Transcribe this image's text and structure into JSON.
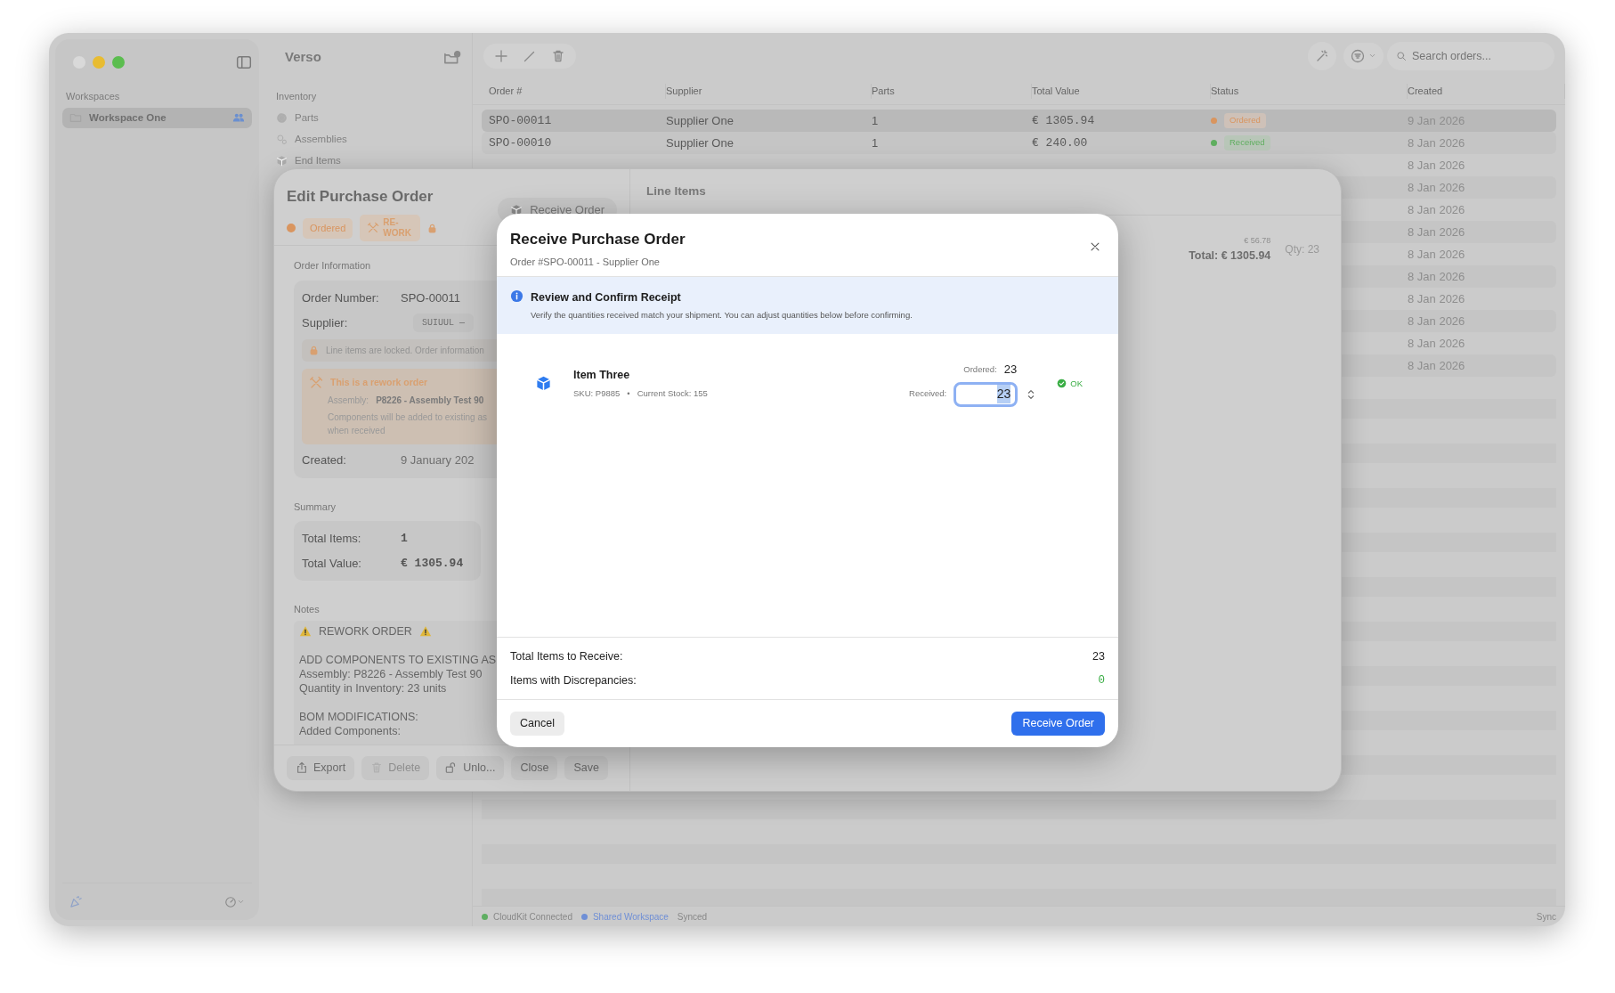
{
  "sidebar": {
    "section": "Workspaces",
    "items": [
      {
        "label": "Workspace One",
        "selected": true,
        "shared": true
      }
    ]
  },
  "middle": {
    "title": "Verso",
    "section": "Inventory",
    "items": [
      {
        "label": "Parts",
        "kind": "gear"
      },
      {
        "label": "Assemblies",
        "kind": "gears"
      },
      {
        "label": "End Items",
        "kind": "box"
      }
    ]
  },
  "toolbar": {
    "search": {
      "placeholder": "Search orders..."
    }
  },
  "table": {
    "columns": [
      "Order #",
      "Supplier",
      "Parts",
      "Total Value",
      "Status",
      "Created"
    ],
    "rows": [
      {
        "order": "SPO-00011",
        "supplier": "Supplier One",
        "parts": "1",
        "total": "€ 1305.94",
        "status": "Ordered",
        "color": "#d9955f",
        "created": "9 Jan 2026",
        "selected": true
      },
      {
        "order": "SPO-00010",
        "supplier": "Supplier One",
        "parts": "1",
        "total": "€ 240.00",
        "status": "Received",
        "color": "#5fae5f",
        "created": "8 Jan 2026",
        "selected": false
      },
      {
        "created": "8 Jan 2026",
        "selected": false
      },
      {
        "created": "8 Jan 2026",
        "selected": false
      },
      {
        "created": "8 Jan 2026",
        "selected": false
      },
      {
        "created": "8 Jan 2026",
        "selected": false
      },
      {
        "created": "8 Jan 2026",
        "selected": false
      },
      {
        "created": "8 Jan 2026",
        "selected": false
      },
      {
        "created": "8 Jan 2026",
        "selected": false
      },
      {
        "created": "8 Jan 2026",
        "selected": false
      },
      {
        "created": "8 Jan 2026",
        "selected": false
      },
      {
        "created": "8 Jan 2026",
        "selected": false
      }
    ]
  },
  "status_bar": {
    "items": [
      {
        "label": "CloudKit Connected",
        "color": "#5fae62",
        "kind": "plain"
      },
      {
        "label": "Shared Workspace",
        "color": "#6f8fd6",
        "kind": "link"
      }
    ],
    "state": "Synced",
    "right": "Sync"
  },
  "edit_sheet": {
    "title": "Edit Purchase Order",
    "status": {
      "label": "Ordered",
      "color": "#d9955f"
    },
    "rework_badge": "RE-WORK",
    "locked": true,
    "receive_button": "Receive Order",
    "order_info": {
      "heading": "Order Information",
      "order_number": {
        "label": "Order Number:",
        "value": "SPO-00011"
      },
      "supplier": {
        "label": "Supplier:",
        "value": "SUIUUL —"
      },
      "lock_notice": "Line items are locked. Order information",
      "rework": {
        "title": "This is a rework order",
        "assembly_label": "Assembly:",
        "assembly": "P8226 - Assembly Test 90",
        "note": [
          "Components will be added to existing as",
          "when received"
        ]
      },
      "created": {
        "label": "Created:",
        "value": "9 January 202"
      }
    },
    "summary": {
      "heading": "Summary",
      "rows": [
        {
          "label": "Total Items:",
          "value": "1"
        },
        {
          "label": "Total Value:",
          "value": "€ 1305.94"
        }
      ]
    },
    "notes": {
      "heading": "Notes",
      "title": "REWORK ORDER",
      "paragraphs": [
        [
          "ADD COMPONENTS TO EXISTING AS",
          "Assembly: P8226 - Assembly Test 90",
          "Quantity in Inventory: 23 units"
        ],
        [
          "BOM MODIFICATIONS:",
          "Added Components:"
        ]
      ]
    },
    "footer_buttons": [
      {
        "label": "Export",
        "kind": "export",
        "disabled": false
      },
      {
        "label": "Delete",
        "kind": "delete",
        "disabled": true
      },
      {
        "label": "Unlo...",
        "kind": "unlock",
        "disabled": false
      },
      {
        "label": "Close",
        "kind": "plain",
        "disabled": false
      },
      {
        "label": "Save",
        "kind": "plain",
        "disabled": false
      }
    ],
    "line_items": {
      "heading": "Line Items",
      "unit_price": "€ 56.78",
      "total": "Total: € 1305.94",
      "qty": "Qty: 23"
    }
  },
  "modal": {
    "title": "Receive Purchase Order",
    "subtitle": "Order #SPO-00011 - Supplier One",
    "banner": {
      "title": "Review and Confirm Receipt",
      "text": "Verify the quantities received match your shipment. You can adjust quantities below before confirming."
    },
    "items": [
      {
        "name": "Item Three",
        "sku": "SKU: P9885",
        "separator": "•",
        "stock": "Current Stock: 155",
        "ordered_label": "Ordered:",
        "ordered": "23",
        "received_label": "Received:",
        "received": "23",
        "status": "OK",
        "ok": true
      }
    ],
    "totals": [
      {
        "label": "Total Items to Receive:",
        "value": "23",
        "kind": "plain"
      },
      {
        "label": "Items with Discrepancies:",
        "value": "0",
        "kind": "good"
      }
    ],
    "cancel": "Cancel",
    "confirm": "Receive Order"
  }
}
